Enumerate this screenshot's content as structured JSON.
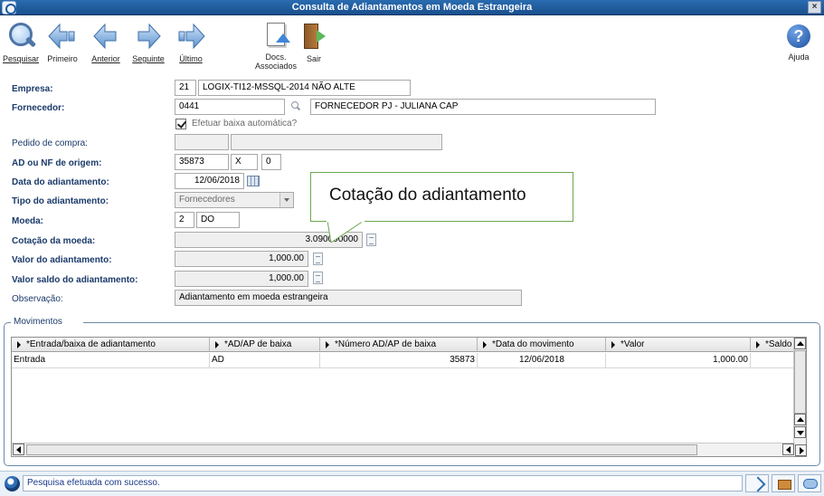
{
  "window": {
    "title": "Consulta de Adiantamentos em Moeda Estrangeira",
    "close_label": "×"
  },
  "toolbar": {
    "pesquisar": "Pesquisar",
    "primeiro": "Primeiro",
    "anterior": "Anterior",
    "seguinte": "Seguinte",
    "ultimo": "Último",
    "docs_line1": "Docs.",
    "docs_line2": "Associados",
    "sair": "Sair",
    "ajuda": "Ajuda"
  },
  "form": {
    "empresa": {
      "label": "Empresa:",
      "code": "21",
      "name": "LOGIX-TI12-MSSQL-2014 NÃO ALTE"
    },
    "fornecedor": {
      "label": "Fornecedor:",
      "code": "0441",
      "name": "FORNECEDOR PJ - JULIANA CAP"
    },
    "baixa_automatica": {
      "label": "Efetuar baixa automática?",
      "checked": true
    },
    "pedido_compra": {
      "label": "Pedido de compra:",
      "value1": "",
      "value2": ""
    },
    "ad_nf_origem": {
      "label": "AD ou NF de origem:",
      "value": "35873",
      "type": "X",
      "seq": "0"
    },
    "data_adiantamento": {
      "label": "Data do adiantamento:",
      "value": "12/06/2018"
    },
    "tipo_adiantamento": {
      "label": "Tipo do adiantamento:",
      "value": "Fornecedores"
    },
    "moeda": {
      "label": "Moeda:",
      "code": "2",
      "name": "DO"
    },
    "cotacao_moeda": {
      "label": "Cotação da moeda:",
      "value": "3.090000000"
    },
    "valor_adiantamento": {
      "label": "Valor do adiantamento:",
      "value": "1,000.00"
    },
    "valor_saldo": {
      "label": "Valor saldo do adiantamento:",
      "value": "1,000.00"
    },
    "observacao": {
      "label": "Observação:",
      "value": "Adiantamento em moeda estrangeira"
    }
  },
  "callout": {
    "text": "Cotação do adiantamento",
    "border_color": "#6aa84f"
  },
  "movimentos": {
    "title": "Movimentos",
    "columns": [
      "*Entrada/baixa de adiantamento",
      "*AD/AP de baixa",
      "*Número AD/AP de baixa",
      "*Data do movimento",
      "*Valor",
      "*Saldo"
    ],
    "rows": [
      [
        "Entrada",
        "AD",
        "35873",
        "12/06/2018",
        "1,000.00",
        ""
      ]
    ]
  },
  "status": {
    "message": "Pesquisa efetuada com sucesso."
  },
  "colors": {
    "titlebar": "#1a4f8e",
    "label_text": "#1a3a6a",
    "status_bg": "#eaf1f8"
  }
}
